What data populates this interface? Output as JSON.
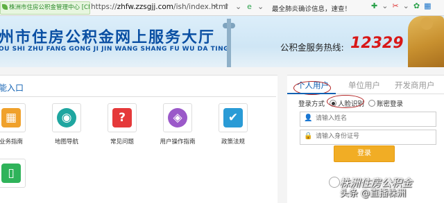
{
  "browser": {
    "site_badge": "株洲市住房公积金管理中心 [CN]",
    "url_scheme": "https://",
    "url_host": "zhfw.zzsgjj.com",
    "url_path": "/ish/index.html",
    "news_ticker": "最全肺炎确诊信息，速查！",
    "icons": [
      "lightning-icon",
      "share-icon",
      "chevron-down-icon",
      "search-icon",
      "plus-icon",
      "scissors-icon",
      "leaf-icon",
      "grid-icon"
    ]
  },
  "banner": {
    "title": "州市住房公积金网上服务大厅",
    "pinyin": "OU SHI ZHU FANG GONG JI JIN WANG SHANG FU WU DA TING",
    "hotline_label": "公积金服务热线:",
    "hotline_number": "12329"
  },
  "main": {
    "section_title": "能入口",
    "tiles": [
      {
        "label": "业务指南",
        "icon": "calculator-icon",
        "color": "#f0a12b",
        "glyph": "▦"
      },
      {
        "label": "地图导航",
        "icon": "globe-icon",
        "color": "#1fa6a0",
        "glyph": "◉"
      },
      {
        "label": "常见问题",
        "icon": "question-icon",
        "color": "#e5393a",
        "glyph": "?"
      },
      {
        "label": "用户操作指南",
        "icon": "compass-icon",
        "color": "#9b59c9",
        "glyph": "◈"
      },
      {
        "label": "政策法规",
        "icon": "document-check-icon",
        "color": "#2a9bd6",
        "glyph": "✔"
      },
      {
        "label": "",
        "icon": "mobile-phone-icon",
        "color": "#2fb35a",
        "glyph": "▯"
      }
    ]
  },
  "login": {
    "tabs": [
      "个人用户",
      "单位用户",
      "开发商用户"
    ],
    "active_tab": 0,
    "mode_label": "登录方式",
    "modes": [
      "人脸识别",
      "账密登录"
    ],
    "selected_mode": 0,
    "name_placeholder": "请输入姓名",
    "id_placeholder": "请输入身份证号",
    "login_label": "登录"
  },
  "watermark": {
    "line1": "株洲住房公积金",
    "line2": "头条 @直播株洲"
  }
}
